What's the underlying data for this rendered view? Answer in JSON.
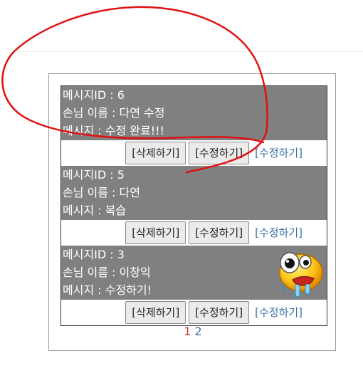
{
  "messages": [
    {
      "id_line": "메시지ID : 6",
      "name_line": "손님 이름 : 다연 수정",
      "message_line": "메시지 : 수정 완료!!!",
      "delete_label": "[삭제하기]",
      "edit_button_label": "[수정하기]",
      "edit_link_label": "[수정하기]"
    },
    {
      "id_line": "메시지ID : 5",
      "name_line": "손님 이름 : 다연",
      "message_line": "메시지 : 복습",
      "delete_label": "[삭제하기]",
      "edit_button_label": "[수정하기]",
      "edit_link_label": "[수정하기]"
    },
    {
      "id_line": "메시지ID : 3",
      "name_line": "손님 이름 : 이창익",
      "message_line": "메시지 : 수정하기!",
      "delete_label": "[삭제하기]",
      "edit_button_label": "[수정하기]",
      "edit_link_label": "[수정하기]",
      "icon": "drooling-smiley-emoticon-icon"
    }
  ],
  "pagination": {
    "pages": [
      "1",
      "2"
    ],
    "current": "1"
  },
  "colors": {
    "info_background": "#808080",
    "link": "#3a6fa8",
    "current_page": "#d63a2a",
    "annotation": "#e01010"
  }
}
